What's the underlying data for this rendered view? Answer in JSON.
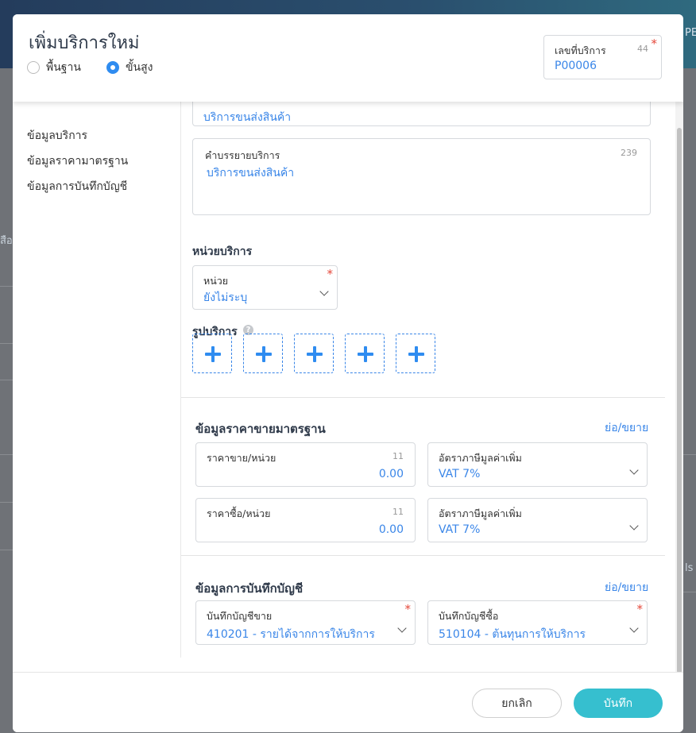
{
  "modal": {
    "title": "เพิ่มบริการใหม่",
    "modes": [
      {
        "label": "พื้นฐาน",
        "selected": false
      },
      {
        "label": "ขั้นสูง",
        "selected": true
      }
    ],
    "service_no": {
      "label": "เลขที่บริการ",
      "value": "P00006",
      "count": "44"
    }
  },
  "nav": {
    "items": [
      "ข้อมูลบริการ",
      "ข้อมูลราคามาตรฐาน",
      "ข้อมูลการบันทึกบัญชี"
    ]
  },
  "service_info": {
    "name_value": "บริการขนส่งสินค้า",
    "description": {
      "label": "คำบรรยายบริการ",
      "value": "บริการขนส่งสินค้า",
      "count": "239"
    },
    "unit_section_title": "หน่วยบริการ",
    "unit": {
      "label": "หน่วย",
      "value": "ยังไม่ระบุ"
    },
    "images_title": "รูปบริการ",
    "help_glyph": "?"
  },
  "pricing": {
    "title": "ข้อมูลราคาขายมาตรฐาน",
    "toggle": "ย่อ/ขยาย",
    "sale_price": {
      "label": "ราคาขาย/หน่วย",
      "value": "0.00",
      "count": "11"
    },
    "sale_vat": {
      "label": "อัตราภาษีมูลค่าเพิ่ม",
      "value": "VAT 7%"
    },
    "buy_price": {
      "label": "ราคาซื้อ/หน่วย",
      "value": "0.00",
      "count": "11"
    },
    "buy_vat": {
      "label": "อัตราภาษีมูลค่าเพิ่ม",
      "value": "VAT 7%"
    }
  },
  "accounting": {
    "title": "ข้อมูลการบันทึกบัญชี",
    "toggle": "ย่อ/ขยาย",
    "sale_account": {
      "label": "บันทึกบัญชีขาย",
      "value": "410201 - รายได้จากการให้บริการ"
    },
    "buy_account": {
      "label": "บันทึกบัญชีซื้อ",
      "value": "510104 - ต้นทุนการให้บริการ"
    }
  },
  "footer": {
    "cancel": "ยกเลิก",
    "save": "บันทึก"
  },
  "backdrop": {
    "left_fragment": "สือ",
    "right_fragment_1": "PE",
    "right_fragment_2": "ls"
  },
  "colors": {
    "accent": "#3a86e8",
    "save_button": "#36bfcf",
    "required": "#e5483b"
  }
}
